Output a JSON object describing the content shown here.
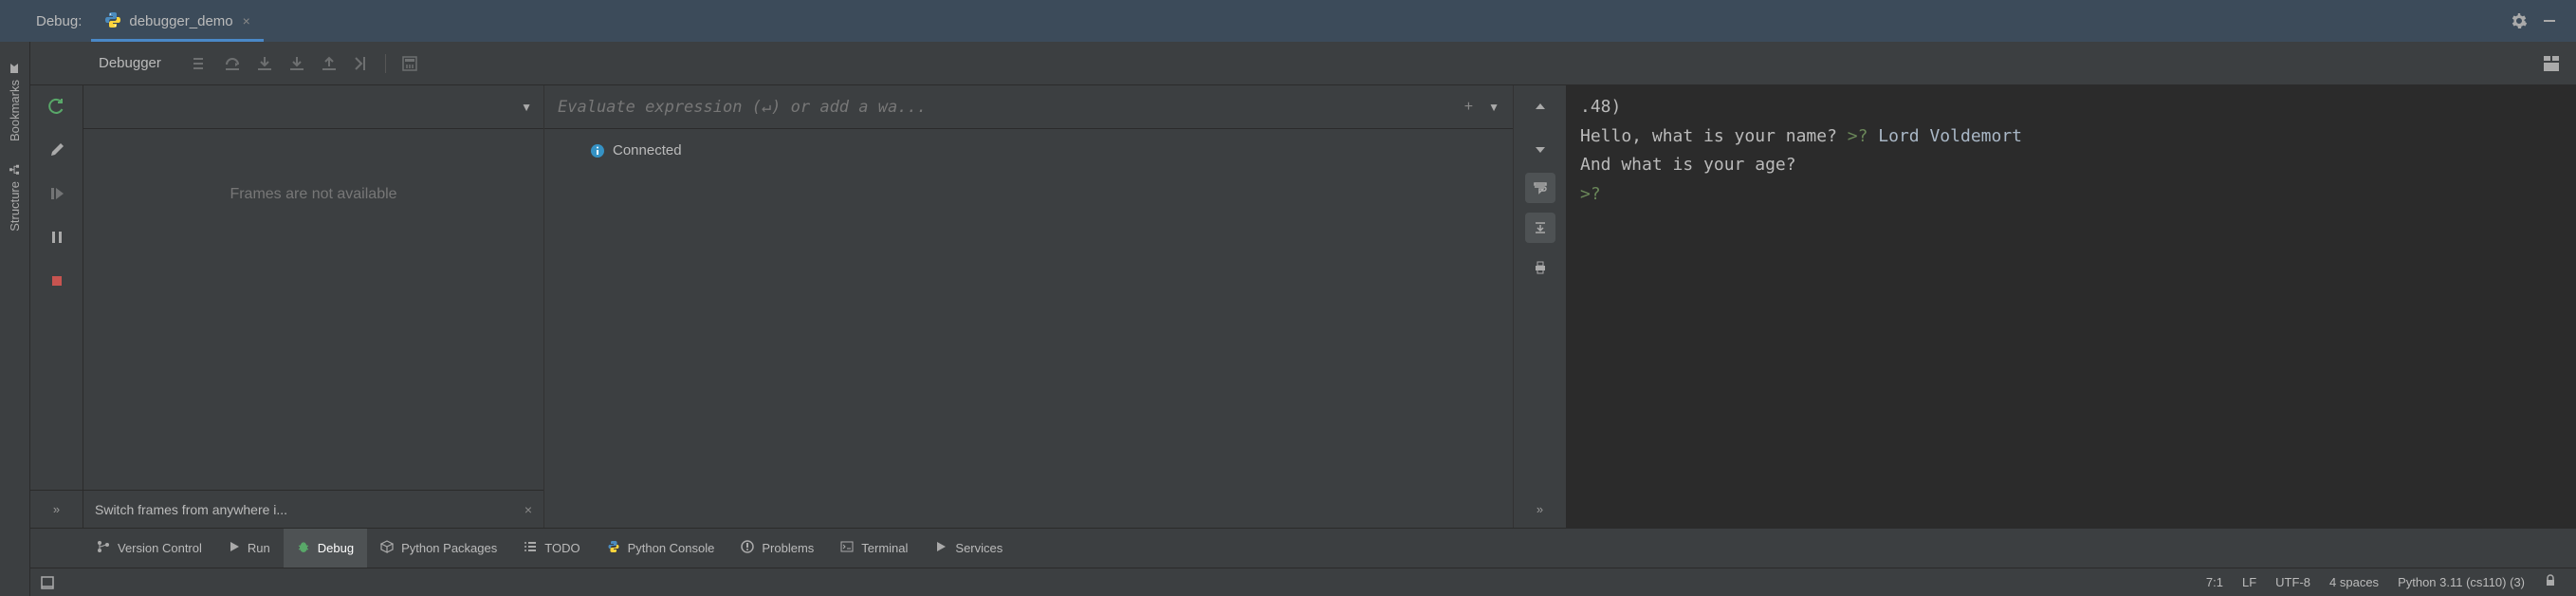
{
  "header": {
    "label": "Debug:",
    "tab_name": "debugger_demo"
  },
  "debugger": {
    "label": "Debugger"
  },
  "frames": {
    "empty_text": "Frames are not available",
    "footer_text": "Switch frames from anywhere i..."
  },
  "vars": {
    "eval_placeholder": "Evaluate expression (↵) or add a wa...",
    "connected_label": "Connected"
  },
  "console": {
    "lines": [
      ".48)",
      "Hello, what is your name? >? Lord Voldemort",
      "And what is your age?",
      ">? "
    ]
  },
  "bottom_tabs": [
    {
      "label": "Version Control",
      "icon": "branch"
    },
    {
      "label": "Run",
      "icon": "play"
    },
    {
      "label": "Debug",
      "icon": "bug",
      "active": true
    },
    {
      "label": "Python Packages",
      "icon": "packages"
    },
    {
      "label": "TODO",
      "icon": "list"
    },
    {
      "label": "Python Console",
      "icon": "python"
    },
    {
      "label": "Problems",
      "icon": "warning"
    },
    {
      "label": "Terminal",
      "icon": "terminal"
    },
    {
      "label": "Services",
      "icon": "services"
    }
  ],
  "left_rail": {
    "bookmarks": "Bookmarks",
    "structure": "Structure"
  },
  "status": {
    "pos": "7:1",
    "line_ending": "LF",
    "encoding": "UTF-8",
    "indent": "4 spaces",
    "interpreter": "Python 3.11 (cs110)",
    "count": "(3)"
  }
}
